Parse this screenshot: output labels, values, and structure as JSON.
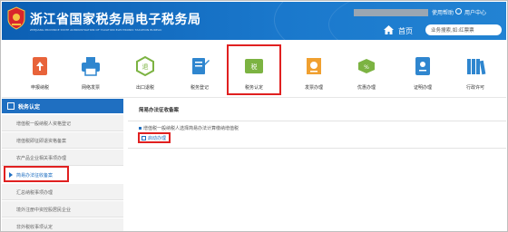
{
  "header": {
    "title": "浙江省国家税务局电子税务局",
    "subtitle": "ZHEJIANG PROVINCE STATE ADMINISTRATION OF TAXATION ELECTRONIC TAXATION BUREAU",
    "logout_label": "使用帮助",
    "user_center_label": "用户中心",
    "home_label": "首页",
    "search_placeholder": "业务搜索,如:红票票"
  },
  "menu": {
    "items": [
      {
        "label": "申报纳税",
        "icon": "tax-declaration-icon",
        "color": "#e8633a"
      },
      {
        "label": "网络发票",
        "icon": "printer-icon",
        "color": "#2f86cf"
      },
      {
        "label": "出口退税",
        "icon": "export-refund-icon",
        "color": "#7cb342"
      },
      {
        "label": "税务登记",
        "icon": "registration-icon",
        "color": "#2f86cf"
      },
      {
        "label": "税务认定",
        "icon": "tax-recognition-icon",
        "color": "#7cb342"
      },
      {
        "label": "发票办理",
        "icon": "invoice-icon",
        "color": "#f0a030"
      },
      {
        "label": "优惠办理",
        "icon": "discount-icon",
        "color": "#7cb342"
      },
      {
        "label": "证明办理",
        "icon": "certificate-icon",
        "color": "#2f86cf"
      },
      {
        "label": "行政许可",
        "icon": "books-icon",
        "color": "#2f86cf"
      }
    ],
    "active_index": 4
  },
  "sidebar": {
    "heading": "税务认定",
    "items": [
      {
        "label": "增值税一般纳税人资格登记"
      },
      {
        "label": "增值税即征即退资格备案"
      },
      {
        "label": "农产品企业相关事项办理"
      },
      {
        "label": "简易办法征收备案",
        "active": true
      },
      {
        "label": "汇总纳税事项办理"
      },
      {
        "label": "境外注册中资控股居民企业"
      },
      {
        "label": "非外税收事项认定"
      }
    ]
  },
  "main": {
    "title": "简易办法征收备案",
    "notice": "增值税一般纳税人选择简易办法计算缴纳增值税",
    "start_button": "启动办理"
  },
  "colors": {
    "header_blue": "#1a78cc",
    "highlight_red": "#e02020",
    "sidebar_blue": "#1f6fc1"
  }
}
